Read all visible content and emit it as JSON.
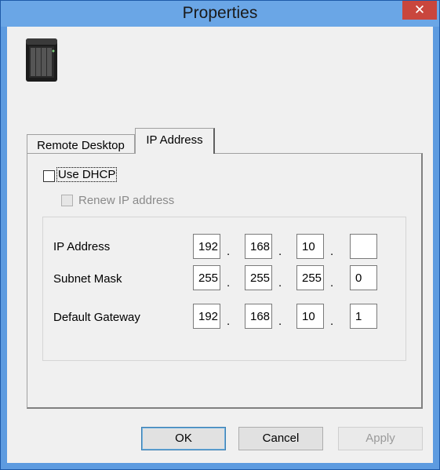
{
  "window": {
    "title": "Properties",
    "close_icon": "close-icon"
  },
  "device_icon": "nas-server-icon",
  "tabs": [
    {
      "label": "Remote Desktop",
      "active": false
    },
    {
      "label": "IP Address",
      "active": true
    }
  ],
  "dhcp": {
    "label": "Use DHCP",
    "checked": false
  },
  "renew": {
    "label": "Renew IP address",
    "checked": false,
    "enabled": false
  },
  "ip_rows": [
    {
      "label": "IP Address",
      "octets": [
        "192",
        "168",
        "10",
        ""
      ]
    },
    {
      "label": "Subnet Mask",
      "octets": [
        "255",
        "255",
        "255",
        "0"
      ]
    },
    {
      "label": "Default Gateway",
      "octets": [
        "192",
        "168",
        "10",
        "1"
      ]
    }
  ],
  "buttons": {
    "ok": "OK",
    "cancel": "Cancel",
    "apply": "Apply"
  },
  "colors": {
    "title_bar": "#6aa6e6",
    "close_button": "#c9463d",
    "dialog_bg": "#f0f0f0"
  }
}
